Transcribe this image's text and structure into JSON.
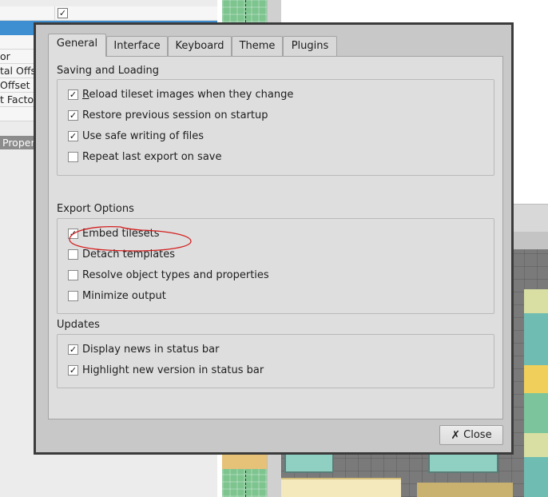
{
  "background": {
    "property_rows": [
      {
        "label": "",
        "checked": true,
        "selected": false
      },
      {
        "label": "",
        "checked": false,
        "selected": true
      },
      {
        "label": "",
        "checked": false,
        "selected": false
      },
      {
        "label": "or",
        "checked": false,
        "selected": false
      },
      {
        "label": "tal Offs",
        "checked": false,
        "selected": false
      },
      {
        "label": " Offset",
        "checked": false,
        "selected": false
      },
      {
        "label": "t Factor",
        "checked": false,
        "selected": false
      }
    ],
    "properties_tab_label": "Proper"
  },
  "dialog": {
    "tabs": [
      {
        "label": "General",
        "active": true
      },
      {
        "label": "Interface",
        "active": false
      },
      {
        "label": "Keyboard",
        "active": false
      },
      {
        "label": "Theme",
        "active": false
      },
      {
        "label": "Plugins",
        "active": false
      }
    ],
    "sections": {
      "saving_loading": {
        "title": "Saving and Loading",
        "items": [
          {
            "mnemonic": "R",
            "rest": "eload tileset images when they change",
            "checked": true
          },
          {
            "mnemonic": "",
            "rest": "Restore previous session on startup",
            "checked": true
          },
          {
            "mnemonic": "",
            "rest": "Use safe writing of files",
            "checked": true
          },
          {
            "mnemonic": "",
            "rest": "Repeat last export on save",
            "checked": false
          }
        ]
      },
      "export_options": {
        "title": "Export Options",
        "items": [
          {
            "label": "Embed tilesets",
            "checked": true
          },
          {
            "label": "Detach templates",
            "checked": false
          },
          {
            "label": "Resolve object types and properties",
            "checked": false
          },
          {
            "label": "Minimize output",
            "checked": false
          }
        ]
      },
      "updates": {
        "title": "Updates",
        "items": [
          {
            "label": "Display news in status bar",
            "checked": true
          },
          {
            "label": "Highlight new version in status bar",
            "checked": true
          }
        ]
      }
    },
    "close_label": "Close",
    "annotation_color": "#d42020"
  }
}
